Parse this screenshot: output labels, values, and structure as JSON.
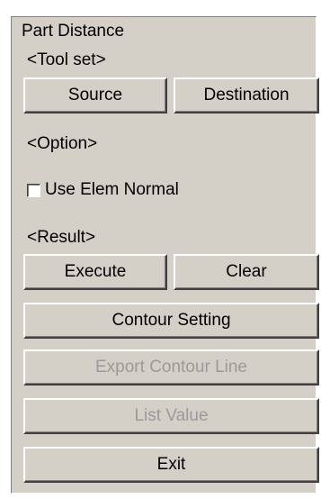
{
  "panel": {
    "title": "Part Distance",
    "toolset_label": "<Tool set>",
    "option_label": "<Option>",
    "result_label": "<Result>"
  },
  "toolset": {
    "source_label": "Source",
    "destination_label": "Destination"
  },
  "option": {
    "use_elem_normal_label": "Use Elem Normal",
    "use_elem_normal_checked": false
  },
  "result": {
    "execute_label": "Execute",
    "clear_label": "Clear"
  },
  "actions": {
    "contour_setting_label": "Contour Setting",
    "export_contour_line_label": "Export Contour Line",
    "export_contour_line_enabled": false,
    "list_value_label": "List Value",
    "list_value_enabled": false,
    "exit_label": "Exit"
  }
}
